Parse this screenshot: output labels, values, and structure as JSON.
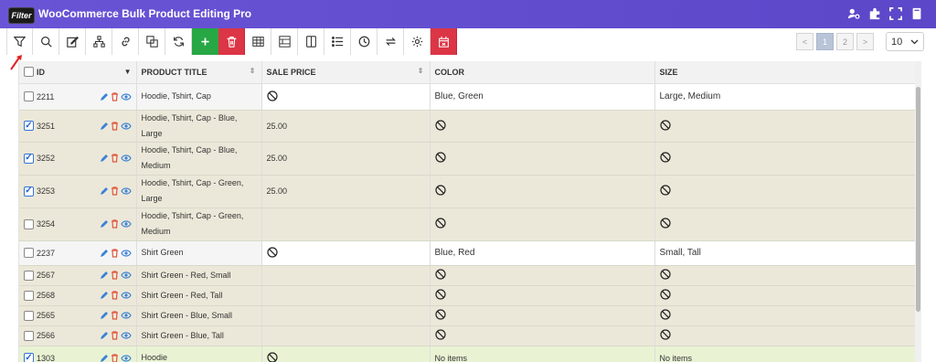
{
  "app": {
    "logo_text": "Filter",
    "title": "WooCommerce Bulk Product Editing Pro",
    "title_icons": [
      "user-settings-icon",
      "puzzle-icon",
      "fullscreen-icon",
      "book-icon"
    ]
  },
  "toolbar": {
    "buttons": [
      "filter-icon",
      "search-icon",
      "edit-icon",
      "hierarchy-icon",
      "link-icon",
      "duplicate-icon",
      "refresh-icon",
      "add-icon",
      "delete-icon",
      "table-icon",
      "columns-icon",
      "column-icon",
      "list-icon",
      "history-icon",
      "swap-icon",
      "settings-icon",
      "trash-all-icon"
    ],
    "add_color": "#28a745",
    "delete_color": "#dc3545"
  },
  "pagination": {
    "prev": "<",
    "pages": [
      "1",
      "2"
    ],
    "current": "1",
    "next": ">",
    "per_page": "10"
  },
  "table": {
    "headers": {
      "id": "ID",
      "title": "PRODUCT TITLE",
      "price": "SALE PRICE",
      "color": "COLOR",
      "size": "SIZE"
    },
    "rows": [
      {
        "id": "2211",
        "checked": false,
        "title": "Hoodie, Tshirt, Cap",
        "price": "",
        "price_none": true,
        "color": "Blue, Green",
        "color_none": false,
        "size": "Large, Medium",
        "size_none": false,
        "style": "white"
      },
      {
        "id": "3251",
        "checked": true,
        "title": "Hoodie, Tshirt, Cap - Blue, Large",
        "price": "25.00",
        "price_none": false,
        "color": "",
        "color_none": true,
        "size": "",
        "size_none": true,
        "style": "beige"
      },
      {
        "id": "3252",
        "checked": true,
        "title": "Hoodie, Tshirt, Cap - Blue, Medium",
        "price": "25.00",
        "price_none": false,
        "color": "",
        "color_none": true,
        "size": "",
        "size_none": true,
        "style": "beige"
      },
      {
        "id": "3253",
        "checked": true,
        "title": "Hoodie, Tshirt, Cap - Green, Large",
        "price": "25.00",
        "price_none": false,
        "color": "",
        "color_none": true,
        "size": "",
        "size_none": true,
        "style": "beige"
      },
      {
        "id": "3254",
        "checked": false,
        "title": "Hoodie, Tshirt, Cap - Green, Medium",
        "price": "",
        "price_none": false,
        "color": "",
        "color_none": true,
        "size": "",
        "size_none": true,
        "style": "beige"
      },
      {
        "id": "2237",
        "checked": false,
        "title": "Shirt Green",
        "price": "",
        "price_none": true,
        "color": "Blue, Red",
        "color_none": false,
        "size": "Small, Tall",
        "size_none": false,
        "style": "white"
      },
      {
        "id": "2567",
        "checked": false,
        "title": "Shirt Green - Red, Small",
        "price": "",
        "price_none": false,
        "color": "",
        "color_none": true,
        "size": "",
        "size_none": true,
        "style": "beige"
      },
      {
        "id": "2568",
        "checked": false,
        "title": "Shirt Green - Red, Tall",
        "price": "",
        "price_none": false,
        "color": "",
        "color_none": true,
        "size": "",
        "size_none": true,
        "style": "beige"
      },
      {
        "id": "2565",
        "checked": false,
        "title": "Shirt Green - Blue, Small",
        "price": "",
        "price_none": false,
        "color": "",
        "color_none": true,
        "size": "",
        "size_none": true,
        "style": "beige"
      },
      {
        "id": "2566",
        "checked": false,
        "title": "Shirt Green - Blue, Tall",
        "price": "",
        "price_none": false,
        "color": "",
        "color_none": true,
        "size": "",
        "size_none": true,
        "style": "beige"
      },
      {
        "id": "1303",
        "checked": true,
        "title": "Hoodie",
        "price": "",
        "price_none": true,
        "color": "No items",
        "color_none": false,
        "size": "No items",
        "size_none": false,
        "style": "green"
      }
    ]
  }
}
